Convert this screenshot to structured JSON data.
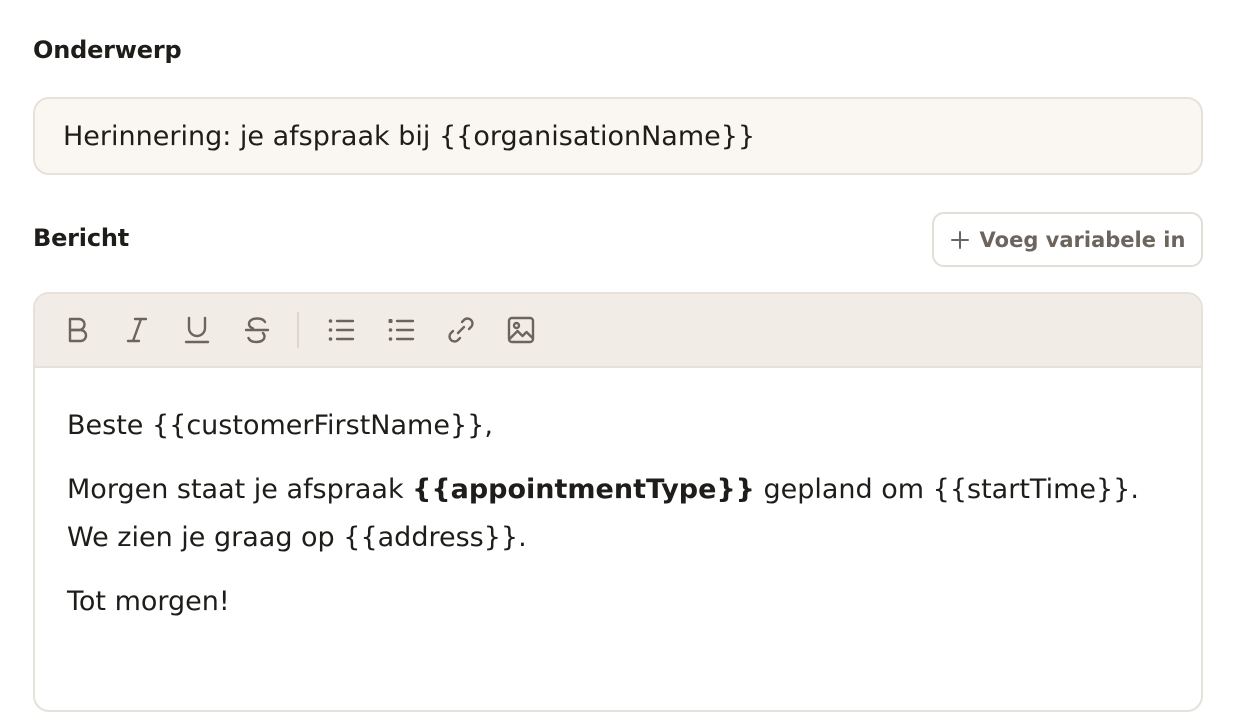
{
  "subject": {
    "label": "Onderwerp",
    "value": "Herinnering: je afspraak bij {{organisationName}}"
  },
  "message": {
    "label": "Bericht",
    "insert_variable_label": "Voeg variabele in",
    "toolbar": [
      {
        "name": "bold-icon"
      },
      {
        "name": "italic-icon"
      },
      {
        "name": "underline-icon"
      },
      {
        "name": "strikethrough-icon"
      },
      {
        "name": "bullet-list-icon"
      },
      {
        "name": "checklist-icon"
      },
      {
        "name": "link-icon"
      },
      {
        "name": "image-icon"
      }
    ],
    "body": {
      "p1": "Beste {{customerFirstName}},",
      "p2_before": "Morgen staat je afspraak ",
      "p2_bold": "{{appointmentType}}",
      "p2_after": " gepland om {{startTime}}. We zien je graag op {{address}}.",
      "p3": "Tot morgen!"
    }
  },
  "colors": {
    "input_bg": "#faf7f2",
    "toolbar_bg": "#f1ece6",
    "border": "#e6e1da",
    "icon": "#6b655d",
    "text": "#1f1d1a"
  }
}
